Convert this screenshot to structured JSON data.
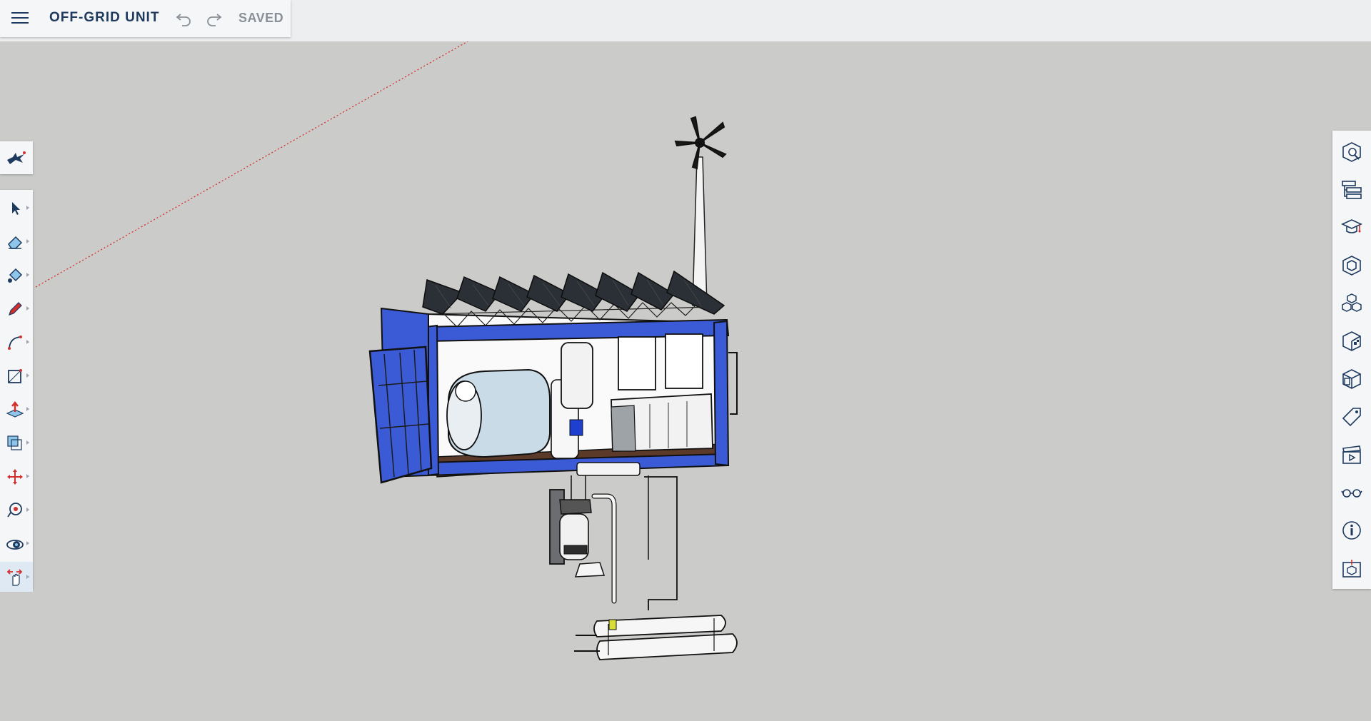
{
  "app": {
    "document_title": "OFF-GRID UNIT",
    "save_status": "SAVED"
  },
  "colors": {
    "background": "#cbcbc9",
    "accent": "#1e3a5f",
    "container_blue": "#3b5bd6",
    "axis_red": "#d32f2f"
  },
  "top_toolbar": {
    "menu_icon": "hamburger-icon",
    "undo_icon": "undo-icon",
    "redo_icon": "redo-icon"
  },
  "left_toolbar": {
    "brand_icon": "sketchup-logo-icon",
    "tools": [
      {
        "name": "select-tool",
        "icon": "arrow-icon"
      },
      {
        "name": "eraser-tool",
        "icon": "eraser-icon"
      },
      {
        "name": "paint-bucket-tool",
        "icon": "paint-bucket-icon"
      },
      {
        "name": "pencil-tool",
        "icon": "pencil-icon"
      },
      {
        "name": "arc-tool",
        "icon": "arc-icon"
      },
      {
        "name": "rectangle-tool",
        "icon": "rectangle-icon"
      },
      {
        "name": "push-pull-tool",
        "icon": "push-pull-icon"
      },
      {
        "name": "offset-tool",
        "icon": "offset-icon"
      },
      {
        "name": "move-tool",
        "icon": "move-icon"
      },
      {
        "name": "tape-measure-tool",
        "icon": "tape-measure-icon"
      },
      {
        "name": "orbit-tool",
        "icon": "orbit-icon"
      },
      {
        "name": "pan-tool",
        "icon": "hand-icon"
      }
    ]
  },
  "right_toolbar": {
    "panels": [
      {
        "name": "entity-info-panel",
        "icon": "entity-info-icon"
      },
      {
        "name": "outliner-panel",
        "icon": "outliner-icon"
      },
      {
        "name": "instructor-panel",
        "icon": "graduation-cap-icon"
      },
      {
        "name": "components-panel",
        "icon": "components-icon"
      },
      {
        "name": "materials-panel",
        "icon": "materials-icon"
      },
      {
        "name": "styles-panel",
        "icon": "styles-icon"
      },
      {
        "name": "views-panel",
        "icon": "views-icon"
      },
      {
        "name": "tags-panel",
        "icon": "tag-icon"
      },
      {
        "name": "scenes-panel",
        "icon": "scenes-icon"
      },
      {
        "name": "display-panel",
        "icon": "glasses-icon"
      },
      {
        "name": "model-info-panel",
        "icon": "info-icon"
      },
      {
        "name": "solid-inspector-panel",
        "icon": "solid-inspector-icon"
      }
    ]
  }
}
